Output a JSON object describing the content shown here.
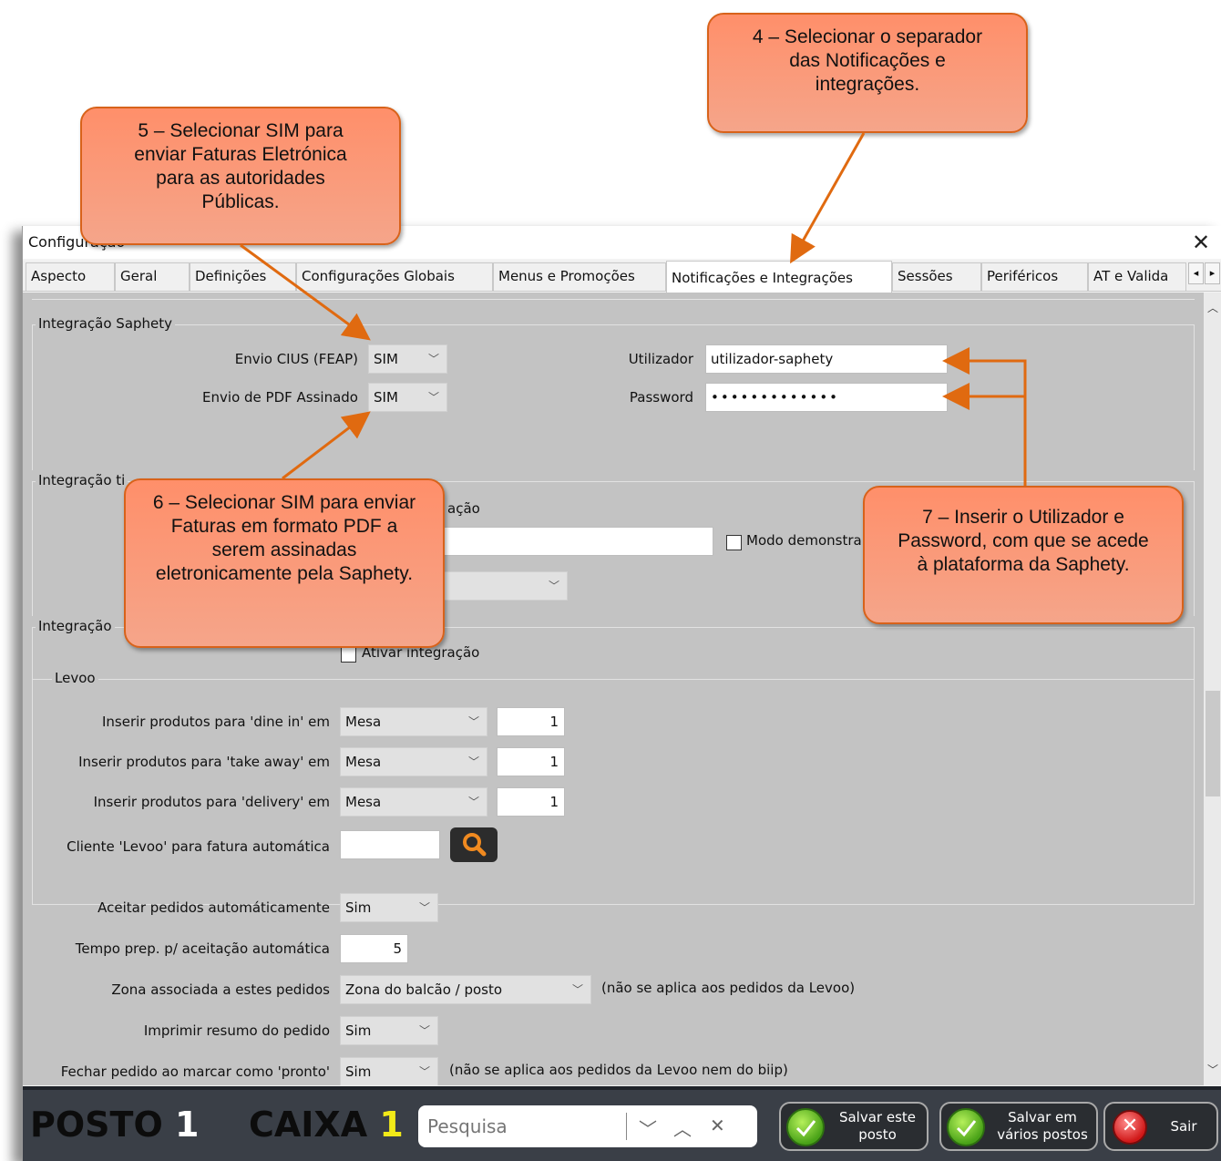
{
  "window": {
    "title": "Configuração",
    "close_icon": "close-icon"
  },
  "tabs": [
    {
      "label": "Aspecto"
    },
    {
      "label": "Geral"
    },
    {
      "label": "Definições"
    },
    {
      "label": "Configurações Globais"
    },
    {
      "label": "Menus e Promoções"
    },
    {
      "label": "Notificações e Integrações",
      "active": true
    },
    {
      "label": "Sessões"
    },
    {
      "label": "Periféricos"
    },
    {
      "label": "AT e Valida"
    }
  ],
  "tab_scroll": {
    "left": "◂",
    "right": "▸"
  },
  "saphety": {
    "group_label": "Integração Saphety",
    "cius_label": "Envio CIUS (FEAP)",
    "cius_value": "SIM",
    "pdf_label": "Envio de PDF Assinado",
    "pdf_value": "SIM",
    "user_label": "Utilizador",
    "user_value": "utilizador-saphety",
    "password_label": "Password",
    "password_value": "•••••••••••••"
  },
  "ticket": {
    "group_label": "Integração ti",
    "activate_fragment": "ação",
    "demo_label": "Modo demonstra"
  },
  "integration3": {
    "group_label": "Integração",
    "activate_label": "Ativar integração"
  },
  "levoo": {
    "group_label": "Levoo",
    "rows": [
      {
        "label": "Inserir produtos para 'dine in' em",
        "value": "Mesa",
        "num": "1"
      },
      {
        "label": "Inserir produtos para 'take away' em",
        "value": "Mesa",
        "num": "1"
      },
      {
        "label": "Inserir produtos para 'delivery' em",
        "value": "Mesa",
        "num": "1"
      }
    ],
    "client_label": "Cliente 'Levoo' para fatura automática",
    "client_value": ""
  },
  "orders": {
    "auto_accept_label": "Aceitar pedidos automáticamente",
    "auto_accept_value": "Sim",
    "prep_time_label": "Tempo prep. p/ aceitação automática",
    "prep_time_value": "5",
    "zone_label": "Zona associada a estes pedidos",
    "zone_value": "Zona do balcão / posto",
    "zone_note": "(não se aplica aos pedidos da Levoo)",
    "print_label": "Imprimir resumo do pedido",
    "print_value": "Sim",
    "close_label": "Fechar pedido ao marcar como 'pronto'",
    "close_value": "Sim",
    "close_note": "(não se aplica aos pedidos da Levoo nem do biip)"
  },
  "bottom": {
    "posto_label": "POSTO",
    "posto_num": "1",
    "caixa_label": "CAIXA",
    "caixa_num": "1",
    "search_placeholder": "Pesquisa",
    "save_this": "Salvar este posto",
    "save_many": "Salvar em vários postos",
    "exit": "Sair"
  },
  "callouts": {
    "c4": "4 – Selecionar o separador das Notificações e integrações.",
    "c5": "5 – Selecionar SIM para enviar Faturas Eletrónica para as autoridades Públicas.",
    "c6": "6 – Selecionar SIM para enviar Faturas em formato PDF a serem assinadas eletronicamente pela Saphety.",
    "c7": "7 – Inserir o Utilizador e Password, com que se acede à plataforma da Saphety."
  },
  "colors": {
    "callout_fill": "#ff8f6a",
    "callout_border": "#d8621a",
    "arrow": "#e06a10",
    "bottom_bar": "#3a3f47",
    "caixa_num": "#f2ea18"
  }
}
